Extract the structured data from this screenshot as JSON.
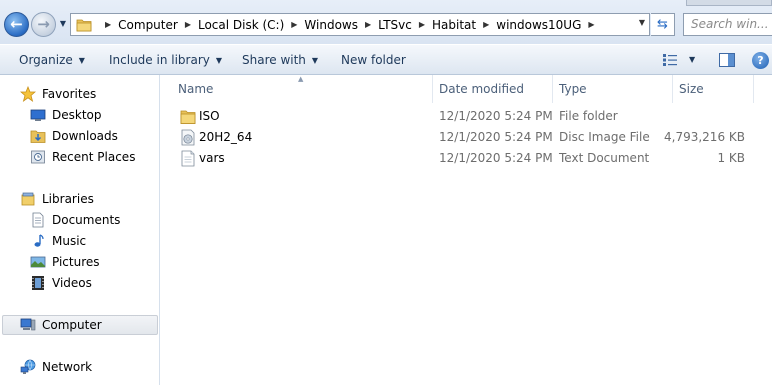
{
  "address_bar": {
    "crumbs": [
      "Computer",
      "Local Disk (C:)",
      "Windows",
      "LTSvc",
      "Habitat",
      "windows10UG"
    ],
    "search_placeholder": "Search win..."
  },
  "toolbar": {
    "organize": "Organize",
    "include_in_library": "Include in library",
    "share_with": "Share with",
    "new_folder": "New folder"
  },
  "nav": {
    "favorites": "Favorites",
    "desktop": "Desktop",
    "downloads": "Downloads",
    "recent_places": "Recent Places",
    "libraries": "Libraries",
    "documents": "Documents",
    "music": "Music",
    "pictures": "Pictures",
    "videos": "Videos",
    "computer": "Computer",
    "network": "Network"
  },
  "columns": {
    "name": "Name",
    "date_modified": "Date modified",
    "type": "Type",
    "size": "Size"
  },
  "files": [
    {
      "name": "ISO",
      "date": "12/1/2020 5:24 PM",
      "type": "File folder",
      "size": "",
      "icon": "folder-icon"
    },
    {
      "name": "20H2_64",
      "date": "12/1/2020 5:24 PM",
      "type": "Disc Image File",
      "size": "4,793,216 KB",
      "icon": "disc-image-icon"
    },
    {
      "name": "vars",
      "date": "12/1/2020 5:24 PM",
      "type": "Text Document",
      "size": "1 KB",
      "icon": "text-document-icon"
    }
  ],
  "colors": {
    "accent": "#1e395b",
    "selection": "#e3e7ec",
    "meta_text": "#6d6d6d"
  }
}
